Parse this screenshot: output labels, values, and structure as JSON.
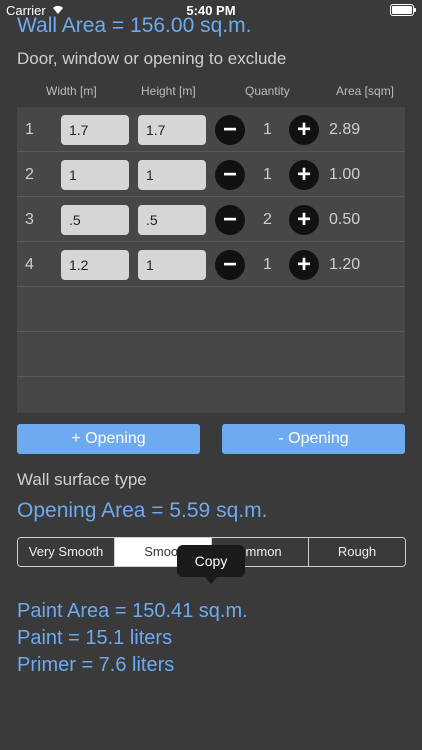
{
  "status": {
    "carrier": "Carrier",
    "time": "5:40 PM"
  },
  "wall_area": "Wall Area = 156.00 sq.m.",
  "exclude_label": "Door, window or opening to exclude",
  "columns": {
    "width": "Width [m]",
    "height": "Height [m]",
    "quantity": "Quantity",
    "area": "Area [sqm]"
  },
  "rows": [
    {
      "index": "1",
      "width": "1.7",
      "height": "1.7",
      "quantity": "1",
      "area": "2.89"
    },
    {
      "index": "2",
      "width": "1",
      "height": "1",
      "quantity": "1",
      "area": "1.00"
    },
    {
      "index": "3",
      "width": ".5",
      "height": ".5",
      "quantity": "2",
      "area": "0.50"
    },
    {
      "index": "4",
      "width": "1.2",
      "height": "1",
      "quantity": "1",
      "area": "1.20"
    }
  ],
  "icons": {
    "minus": "minus-icon",
    "plus": "plus-icon"
  },
  "buttons": {
    "add_opening": "+ Opening",
    "remove_opening": "- Opening"
  },
  "surface_label": "Wall surface type",
  "opening_area": "Opening Area = 5.59 sq.m.",
  "surface_types": [
    "Very Smooth",
    "Smooth",
    "Common",
    "Rough"
  ],
  "surface_display": [
    "Very Smooth",
    "Smoot",
    "ommon",
    "Rough"
  ],
  "selected_surface": "Smooth",
  "tooltip": "Copy",
  "results": {
    "paint_area": "Paint Area = 150.41 sq.m.",
    "paint": "Paint = 15.1 liters",
    "primer": "Primer = 7.6 liters"
  },
  "colors": {
    "accent": "#6eaaf0",
    "background": "#3a3a3a",
    "table": "#474747"
  }
}
